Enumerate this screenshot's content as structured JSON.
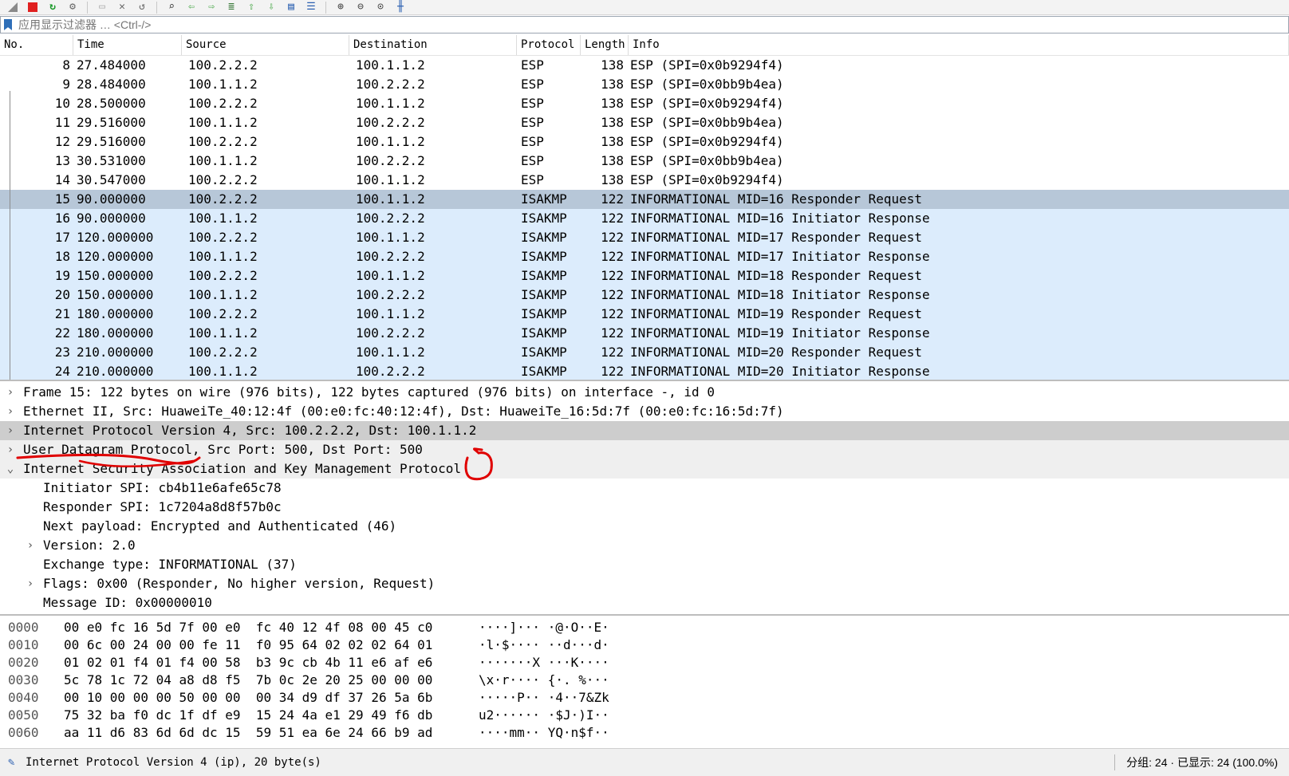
{
  "toolbar": {
    "icons": [
      "shark-fin-icon",
      "stop-icon",
      "restart-icon",
      "options-icon",
      "open-icon",
      "close-icon",
      "reload-icon",
      "find-icon",
      "back-icon",
      "forward-icon",
      "goto-icon",
      "first-icon",
      "last-icon",
      "autoscroll-icon",
      "colorize-icon",
      "zoom-in-icon",
      "zoom-out-icon",
      "zoom-reset-icon",
      "resize-columns-icon"
    ]
  },
  "filter": {
    "placeholder": "应用显示过滤器 … <Ctrl-/>"
  },
  "packet_list": {
    "columns": [
      "No.",
      "Time",
      "Source",
      "Destination",
      "Protocol",
      "Length",
      "Info"
    ],
    "rows": [
      {
        "no": "8",
        "time": "27.484000",
        "src": "100.2.2.2",
        "dst": "100.1.1.2",
        "proto": "ESP",
        "len": "138",
        "info": "ESP (SPI=0x0b9294f4)"
      },
      {
        "no": "9",
        "time": "28.484000",
        "src": "100.1.1.2",
        "dst": "100.2.2.2",
        "proto": "ESP",
        "len": "138",
        "info": "ESP (SPI=0x0bb9b4ea)"
      },
      {
        "no": "10",
        "time": "28.500000",
        "src": "100.2.2.2",
        "dst": "100.1.1.2",
        "proto": "ESP",
        "len": "138",
        "info": "ESP (SPI=0x0b9294f4)"
      },
      {
        "no": "11",
        "time": "29.516000",
        "src": "100.1.1.2",
        "dst": "100.2.2.2",
        "proto": "ESP",
        "len": "138",
        "info": "ESP (SPI=0x0bb9b4ea)"
      },
      {
        "no": "12",
        "time": "29.516000",
        "src": "100.2.2.2",
        "dst": "100.1.1.2",
        "proto": "ESP",
        "len": "138",
        "info": "ESP (SPI=0x0b9294f4)"
      },
      {
        "no": "13",
        "time": "30.531000",
        "src": "100.1.1.2",
        "dst": "100.2.2.2",
        "proto": "ESP",
        "len": "138",
        "info": "ESP (SPI=0x0bb9b4ea)"
      },
      {
        "no": "14",
        "time": "30.547000",
        "src": "100.2.2.2",
        "dst": "100.1.1.2",
        "proto": "ESP",
        "len": "138",
        "info": "ESP (SPI=0x0b9294f4)"
      },
      {
        "no": "15",
        "time": "90.000000",
        "src": "100.2.2.2",
        "dst": "100.1.1.2",
        "proto": "ISAKMP",
        "len": "122",
        "info": "INFORMATIONAL MID=16 Responder Request"
      },
      {
        "no": "16",
        "time": "90.000000",
        "src": "100.1.1.2",
        "dst": "100.2.2.2",
        "proto": "ISAKMP",
        "len": "122",
        "info": "INFORMATIONAL MID=16 Initiator Response"
      },
      {
        "no": "17",
        "time": "120.000000",
        "src": "100.2.2.2",
        "dst": "100.1.1.2",
        "proto": "ISAKMP",
        "len": "122",
        "info": "INFORMATIONAL MID=17 Responder Request"
      },
      {
        "no": "18",
        "time": "120.000000",
        "src": "100.1.1.2",
        "dst": "100.2.2.2",
        "proto": "ISAKMP",
        "len": "122",
        "info": "INFORMATIONAL MID=17 Initiator Response"
      },
      {
        "no": "19",
        "time": "150.000000",
        "src": "100.2.2.2",
        "dst": "100.1.1.2",
        "proto": "ISAKMP",
        "len": "122",
        "info": "INFORMATIONAL MID=18 Responder Request"
      },
      {
        "no": "20",
        "time": "150.000000",
        "src": "100.1.1.2",
        "dst": "100.2.2.2",
        "proto": "ISAKMP",
        "len": "122",
        "info": "INFORMATIONAL MID=18 Initiator Response"
      },
      {
        "no": "21",
        "time": "180.000000",
        "src": "100.2.2.2",
        "dst": "100.1.1.2",
        "proto": "ISAKMP",
        "len": "122",
        "info": "INFORMATIONAL MID=19 Responder Request"
      },
      {
        "no": "22",
        "time": "180.000000",
        "src": "100.1.1.2",
        "dst": "100.2.2.2",
        "proto": "ISAKMP",
        "len": "122",
        "info": "INFORMATIONAL MID=19 Initiator Response"
      },
      {
        "no": "23",
        "time": "210.000000",
        "src": "100.2.2.2",
        "dst": "100.1.1.2",
        "proto": "ISAKMP",
        "len": "122",
        "info": "INFORMATIONAL MID=20 Responder Request"
      },
      {
        "no": "24",
        "time": "210.000000",
        "src": "100.1.1.2",
        "dst": "100.2.2.2",
        "proto": "ISAKMP",
        "len": "122",
        "info": "INFORMATIONAL MID=20 Initiator Response"
      }
    ],
    "selected_no": "15"
  },
  "details": [
    {
      "text": "Frame 15: 122 bytes on wire (976 bits), 122 bytes captured (976 bits) on interface -, id 0",
      "level": 0,
      "arrow": "›",
      "style": ""
    },
    {
      "text": "Ethernet II, Src: HuaweiTe_40:12:4f (00:e0:fc:40:12:4f), Dst: HuaweiTe_16:5d:7f (00:e0:fc:16:5d:7f)",
      "level": 0,
      "arrow": "›",
      "style": ""
    },
    {
      "text": "Internet Protocol Version 4, Src: 100.2.2.2, Dst: 100.1.1.2",
      "level": 0,
      "arrow": "›",
      "style": "sel"
    },
    {
      "text": "User Datagram Protocol, Src Port: 500, Dst Port: 500",
      "level": 0,
      "arrow": "›",
      "style": "alt"
    },
    {
      "text": "Internet Security Association and Key Management Protocol",
      "level": 0,
      "arrow": "⌄",
      "style": "alt"
    },
    {
      "text": "Initiator SPI: cb4b11e6afe65c78",
      "level": 1,
      "arrow": "",
      "style": ""
    },
    {
      "text": "Responder SPI: 1c7204a8d8f57b0c",
      "level": 1,
      "arrow": "",
      "style": ""
    },
    {
      "text": "Next payload: Encrypted and Authenticated (46)",
      "level": 1,
      "arrow": "",
      "style": ""
    },
    {
      "text": "Version: 2.0",
      "level": 1,
      "arrow": "›",
      "style": ""
    },
    {
      "text": "Exchange type: INFORMATIONAL (37)",
      "level": 1,
      "arrow": "",
      "style": ""
    },
    {
      "text": "Flags: 0x00 (Responder, No higher version, Request)",
      "level": 1,
      "arrow": "›",
      "style": ""
    },
    {
      "text": "Message ID: 0x00000010",
      "level": 1,
      "arrow": "",
      "style": ""
    }
  ],
  "bytes": [
    {
      "offset": "0000",
      "hex": "00 e0 fc 16 5d 7f 00 e0  fc 40 12 4f 08 00 45 c0",
      "ascii": "····]··· ·@·O··E·"
    },
    {
      "offset": "0010",
      "hex": "00 6c 00 24 00 00 fe 11  f0 95 64 02 02 02 64 01",
      "ascii": "·l·$···· ··d···d·"
    },
    {
      "offset": "0020",
      "hex": "01 02 01 f4 01 f4 00 58  b3 9c cb 4b 11 e6 af e6",
      "ascii": "·······X ···K····"
    },
    {
      "offset": "0030",
      "hex": "5c 78 1c 72 04 a8 d8 f5  7b 0c 2e 20 25 00 00 00",
      "ascii": "\\x·r···· {·. %···"
    },
    {
      "offset": "0040",
      "hex": "00 10 00 00 00 50 00 00  00 34 d9 df 37 26 5a 6b",
      "ascii": "·····P·· ·4··7&Zk"
    },
    {
      "offset": "0050",
      "hex": "75 32 ba f0 dc 1f df e9  15 24 4a e1 29 49 f6 db",
      "ascii": "u2······ ·$J·)I··"
    },
    {
      "offset": "0060",
      "hex": "aa 11 d6 83 6d 6d dc 15  59 51 ea 6e 24 66 b9 ad",
      "ascii": "····mm·· YQ·n$f··"
    }
  ],
  "status": {
    "left": "Internet Protocol Version 4 (ip), 20 byte(s)",
    "right": "分组: 24 · 已显示: 24 (100.0%)"
  },
  "colors": {
    "selected_row": "#b7c7d8",
    "isakmp_row": "#dcecfc",
    "annotation_red": "#e00000"
  }
}
